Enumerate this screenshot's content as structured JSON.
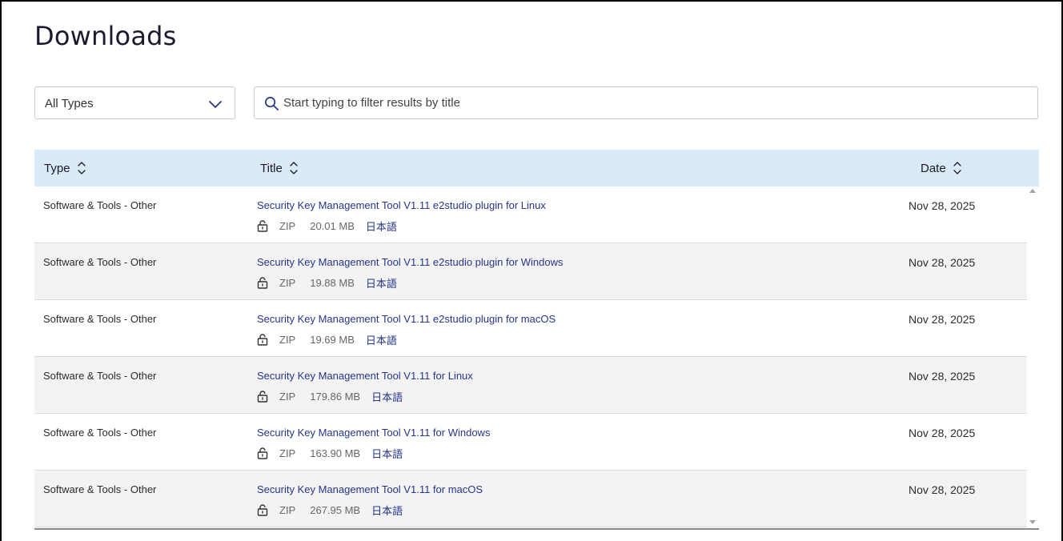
{
  "page": {
    "title": "Downloads"
  },
  "filters": {
    "type_select": {
      "value": "All Types"
    },
    "search": {
      "placeholder": "Start typing to filter results by title",
      "value": ""
    }
  },
  "table": {
    "headers": {
      "type": "Type",
      "title": "Title",
      "date": "Date"
    },
    "rows": [
      {
        "type": "Software & Tools - Other",
        "title": "Security Key Management Tool V1.11 e2studio plugin for Linux",
        "file_type": "ZIP",
        "size": "20.01 MB",
        "language": "日本語",
        "date": "Nov 28, 2025"
      },
      {
        "type": "Software & Tools - Other",
        "title": "Security Key Management Tool V1.11 e2studio plugin for Windows",
        "file_type": "ZIP",
        "size": "19.88 MB",
        "language": "日本語",
        "date": "Nov 28, 2025"
      },
      {
        "type": "Software & Tools - Other",
        "title": "Security Key Management Tool V1.11 e2studio plugin for macOS",
        "file_type": "ZIP",
        "size": "19.69 MB",
        "language": "日本語",
        "date": "Nov 28, 2025"
      },
      {
        "type": "Software & Tools - Other",
        "title": "Security Key Management Tool V1.11 for Linux",
        "file_type": "ZIP",
        "size": "179.86 MB",
        "language": "日本語",
        "date": "Nov 28, 2025"
      },
      {
        "type": "Software & Tools - Other",
        "title": "Security Key Management Tool V1.11 for Windows",
        "file_type": "ZIP",
        "size": "163.90 MB",
        "language": "日本語",
        "date": "Nov 28, 2025"
      },
      {
        "type": "Software & Tools - Other",
        "title": "Security Key Management Tool V1.11 for macOS",
        "file_type": "ZIP",
        "size": "267.95 MB",
        "language": "日本語",
        "date": "Nov 28, 2025"
      }
    ]
  },
  "colors": {
    "header_bg": "#dbeaf8",
    "link": "#26358c",
    "alt_row": "#f3f3f3"
  },
  "icons": {
    "select": "chevron-down-icon",
    "search": "search-icon",
    "sort": "sort-icon",
    "lock": "lock-icon"
  }
}
